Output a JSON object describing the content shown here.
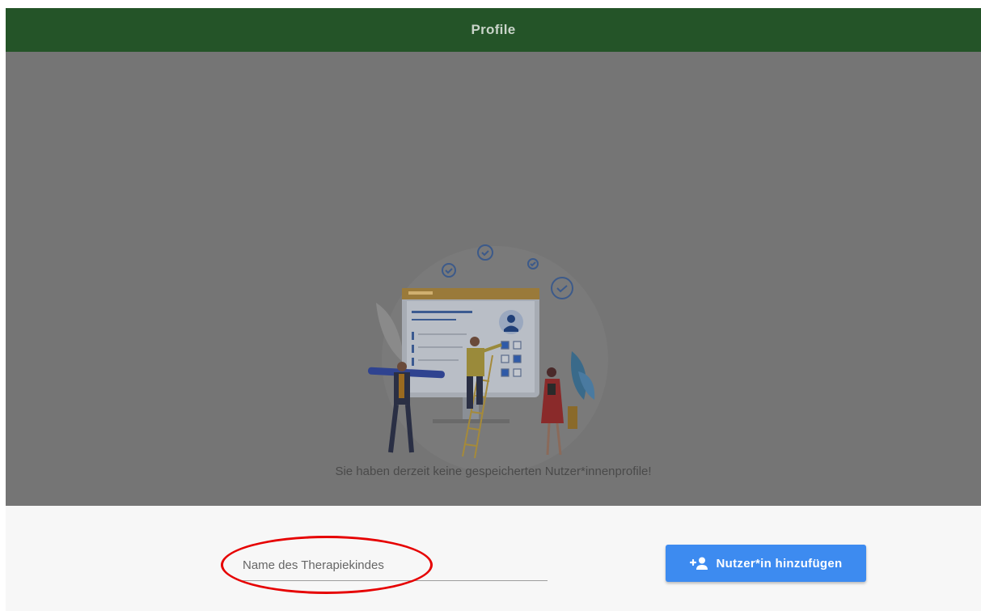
{
  "appbar": {
    "title": "Profile"
  },
  "empty_state": {
    "message": "Sie haben derzeit keine gespeicherten Nutzer*innenprofile!",
    "illustration": "profile-checklist-illustration-icon"
  },
  "form": {
    "name_placeholder": "Name des Therapiekindes",
    "name_value": "",
    "add_button_label": "Nutzer*in hinzufügen",
    "add_button_icon": "add-person-icon"
  },
  "annotation": {
    "highlight": "red-ellipse-around-name-field"
  },
  "colors": {
    "appbar": "#245428",
    "overlay": "#757575",
    "button": "#3d8bf0",
    "highlight": "#e60000"
  }
}
